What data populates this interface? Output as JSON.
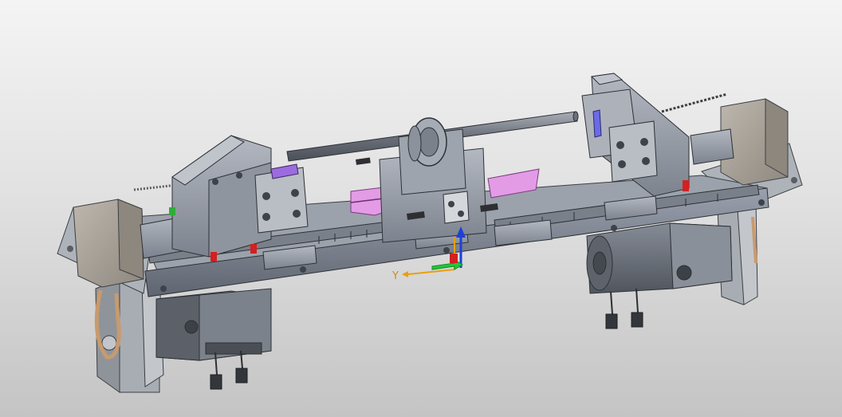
{
  "viewport": {
    "background_top": "#f4f4f4",
    "background_bottom": "#c4c4c4"
  },
  "triad": {
    "y_axis_label": "Y",
    "x_axis_color": "#e8a010",
    "y_axis_color": "#e8a010",
    "z_axis_color": "#1f3fd6",
    "green_arrow_color": "#22c83a"
  },
  "model": {
    "frame_color": "#7e8593",
    "part_color": "#9aa0ab",
    "motor_color": "#6d737d",
    "cover_color": "#a8a29a",
    "highlight_pink": "#e39be6",
    "highlight_violet": "#9c6be0",
    "marker_red": "#d32020",
    "marker_green": "#2fae3a",
    "cable_color": "#c89a6e"
  }
}
